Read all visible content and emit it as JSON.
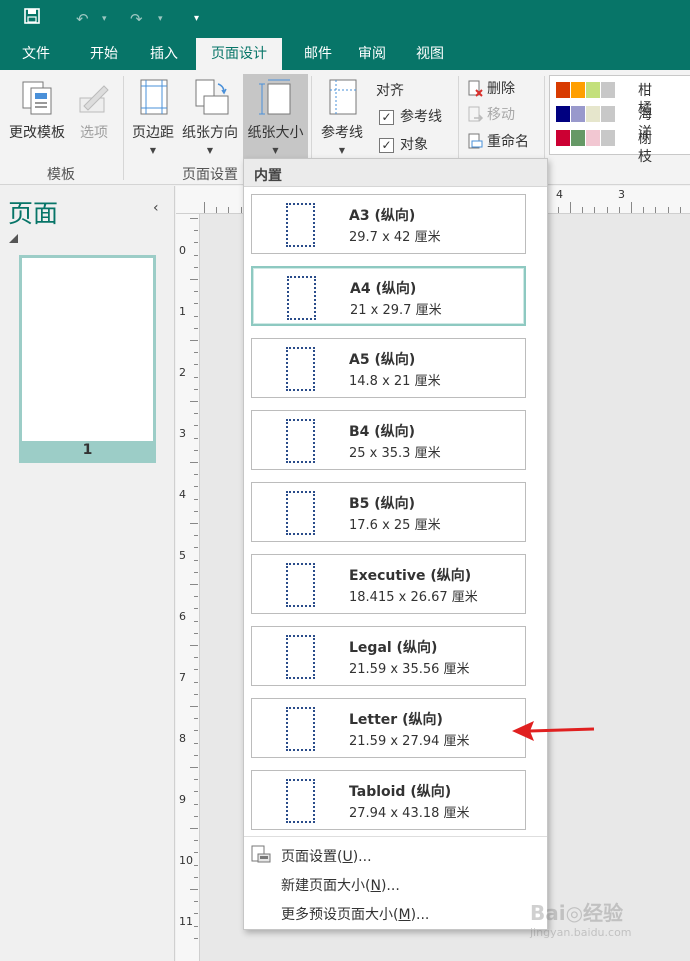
{
  "titlebar": {
    "save_icon": "save-icon",
    "undo_icon": "undo-icon",
    "redo_icon": "redo-icon",
    "customize_icon": "customize-qat-icon"
  },
  "tabs": [
    {
      "label": "文件"
    },
    {
      "label": "开始"
    },
    {
      "label": "插入"
    },
    {
      "label": "页面设计",
      "active": true
    },
    {
      "label": "邮件"
    },
    {
      "label": "审阅"
    },
    {
      "label": "视图"
    }
  ],
  "ribbon": {
    "template_group": {
      "change_template": "更改模板",
      "options": "选项",
      "label": "模板"
    },
    "page_setup_group": {
      "margins": "页边距",
      "orientation": "纸张方向",
      "size": "纸张大小",
      "label": "页面设置"
    },
    "guides": "参考线",
    "align": {
      "title": "对齐",
      "guides": "参考线",
      "objects": "对象"
    },
    "pages": {
      "delete": "删除",
      "move": "移动",
      "rename": "重命名"
    },
    "color_schemes": [
      {
        "name": "柑橘",
        "colors": [
          "#d83b01",
          "#ff9f00",
          "#c3e07b",
          "#c8c8c8"
        ]
      },
      {
        "name": "海洋",
        "colors": [
          "#000080",
          "#9999cc",
          "#e6e6cc",
          "#c8c8c8"
        ]
      },
      {
        "name": "榭枝",
        "colors": [
          "#cc0033",
          "#669966",
          "#f2c7d2",
          "#c8c8c8"
        ]
      }
    ]
  },
  "pages_pane": {
    "title": "页面",
    "collapse": "‹",
    "page_number": "1"
  },
  "ruler": {
    "vertical": [
      "0",
      "1",
      "2",
      "3",
      "4",
      "5",
      "6",
      "7",
      "8",
      "9",
      "10",
      "11"
    ],
    "horizontal_right": [
      "4",
      "3"
    ]
  },
  "dropdown": {
    "header": "内置",
    "sizes": [
      {
        "name": "A3 (纵向)",
        "dims": "29.7 x 42 厘米"
      },
      {
        "name": "A4 (纵向)",
        "dims": "21 x 29.7 厘米",
        "selected": true
      },
      {
        "name": "A5 (纵向)",
        "dims": "14.8 x 21 厘米"
      },
      {
        "name": "B4 (纵向)",
        "dims": "25 x 35.3 厘米"
      },
      {
        "name": "B5 (纵向)",
        "dims": "17.6 x 25 厘米"
      },
      {
        "name": "Executive (纵向)",
        "dims": "18.415 x 26.67 厘米"
      },
      {
        "name": "Legal (纵向)",
        "dims": "21.59 x 35.56 厘米"
      },
      {
        "name": "Letter (纵向)",
        "dims": "21.59 x 27.94 厘米"
      },
      {
        "name": "Tabloid (纵向)",
        "dims": "27.94 x 43.18 厘米"
      }
    ],
    "commands": {
      "page_setup": {
        "text": "页面设置(",
        "key": "U",
        "suffix": ")..."
      },
      "new_size": {
        "text": "新建页面大小(",
        "key": "N",
        "suffix": ")..."
      },
      "more_sizes": {
        "text": "更多预设页面大小(",
        "key": "M",
        "suffix": ")..."
      }
    }
  },
  "watermark": {
    "brand": "Bai◎经验",
    "sub": "jingyan.baidu.com"
  },
  "accent_color": "#077568",
  "annotation_arrow_color": "#e02020"
}
